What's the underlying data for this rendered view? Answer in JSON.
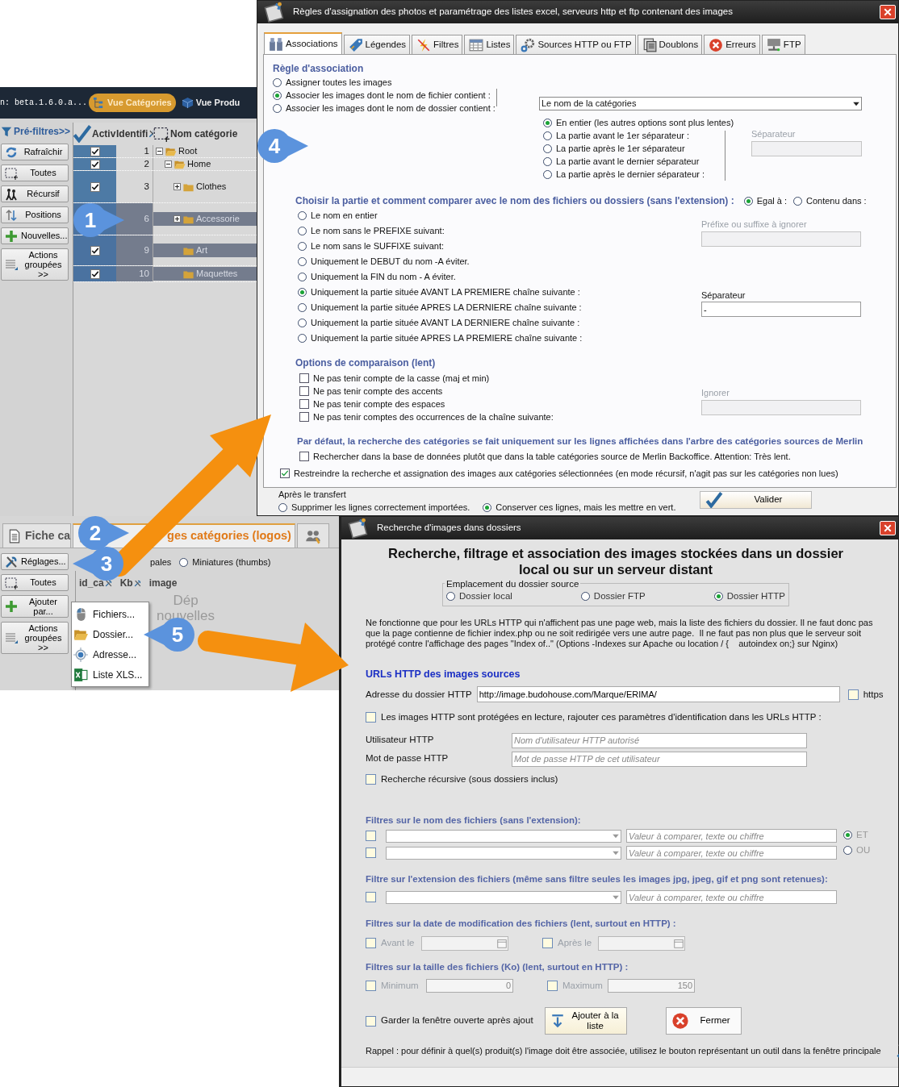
{
  "background_app": {
    "version": "n: beta.1.6.0.a...",
    "view_tabs": [
      {
        "label": "Vue Catégories",
        "selected": true
      },
      {
        "label": "Vue Produ",
        "selected": false
      }
    ],
    "sidebar": [
      "Pré-filtres>>",
      "Rafraîchir",
      "Toutes",
      "Récursif",
      "Positions",
      "Nouvelles...",
      "Actions groupées >>"
    ],
    "grid_columns": [
      "Activ",
      "Identifi",
      "Nom catégorie"
    ],
    "tree": [
      {
        "id": "1",
        "name": "Root",
        "checked": true,
        "selected": false,
        "expanded": true,
        "children": [
          {
            "id": "2",
            "name": "Home",
            "checked": true,
            "selected": false,
            "expanded": true,
            "children": [
              {
                "id": "3",
                "name": "Clothes",
                "checked": true,
                "selected": false,
                "expanded": false
              },
              {
                "id": "6",
                "name": "Accessorie",
                "selected": true,
                "expanded": false
              },
              {
                "id": "9",
                "name": "Art",
                "checked": true,
                "selected": true
              },
              {
                "id": "10",
                "name": "Maquettes",
                "checked": true,
                "selected": true
              }
            ]
          }
        ]
      }
    ],
    "lower_tabs": [
      {
        "label": "Fiche ca",
        "selected": false
      },
      {
        "label": "ges catégories (logos)",
        "selected": true
      }
    ],
    "lower_buttons": [
      "Réglages...",
      "Toutes",
      "Ajouter par...",
      "Actions groupées >>"
    ],
    "image_type_partial": "pales",
    "image_type": [
      {
        "label": "Miniatures (thumbs)",
        "selected": false
      }
    ],
    "image_columns": [
      "id_ca",
      "Kb",
      "image"
    ],
    "drop_hint": [
      "Dép",
      "nouvelles"
    ],
    "context_menu": [
      "Fichiers...",
      "Dossier...",
      "Adresse...",
      "Liste XLS..."
    ]
  },
  "callouts": [
    "1",
    "2",
    "3",
    "4",
    "5"
  ],
  "rules_dialog": {
    "title": "Règles d'assignation des photos et paramétrage des listes excel, serveurs http et ftp contenant des images",
    "tabs": [
      {
        "label": "Associations",
        "selected": true
      },
      {
        "label": "Légendes",
        "selected": false
      },
      {
        "label": "Filtres",
        "selected": false
      },
      {
        "label": "Listes",
        "selected": false
      },
      {
        "label": "Sources HTTP ou FTP",
        "selected": false
      },
      {
        "label": "Doublons",
        "selected": false
      },
      {
        "label": "Erreurs",
        "selected": false
      },
      {
        "label": "FTP",
        "selected": false
      }
    ],
    "association_heading": "Règle d'association",
    "association_rules": [
      {
        "label": "Assigner toutes les images",
        "selected": false
      },
      {
        "label": "Associer les images dont le nom de fichier contient :",
        "selected": true
      },
      {
        "label": "Associer les images dont le nom de dossier contient :",
        "selected": false
      }
    ],
    "source_select": {
      "value": "Le nom de la catégories"
    },
    "name_parts": [
      {
        "label": "En entier (les autres options sont plus lentes)",
        "selected": true
      },
      {
        "label": "La partie avant le 1er séparateur :",
        "selected": false
      },
      {
        "label": "La partie après le 1er séparateur",
        "selected": false
      },
      {
        "label": "La partie avant le dernier séparateur",
        "selected": false
      },
      {
        "label": "La partie après le dernier séparateur :",
        "selected": false
      }
    ],
    "separator_1": {
      "label": "Séparateur",
      "disabled": true
    },
    "compare_heading": "Choisir la partie et comment comparer avec le nom des fichiers ou dossiers (sans l'extension) :",
    "compare_modes": [
      {
        "label": "Egal à :",
        "selected": true
      },
      {
        "label": "Contenu dans :",
        "selected": false
      }
    ],
    "file_parts": [
      {
        "label": "Le nom en entier",
        "selected": false
      },
      {
        "label": "Le nom sans le PREFIXE suivant:",
        "selected": false
      },
      {
        "label": "Le nom sans le SUFFIXE suivant:",
        "selected": false
      },
      {
        "label": "Uniquement le DEBUT du nom -A éviter.",
        "selected": false
      },
      {
        "label": "Uniquement la FIN du nom - A éviter.",
        "selected": false
      },
      {
        "label": "Uniquement la partie située AVANT LA PREMIERE chaîne suivante :",
        "selected": true
      },
      {
        "label": "Uniquement la partie située APRES LA DERNIERE chaîne suivante :",
        "selected": false
      },
      {
        "label": "Uniquement la partie située AVANT LA DERNIERE chaîne suivante :",
        "selected": false
      },
      {
        "label": "Uniquement la partie située APRES LA PREMIERE chaîne suivante :",
        "selected": false
      }
    ],
    "prefix_field": {
      "label": "Préfixe ou suffixe à ignorer",
      "disabled": true
    },
    "separator_2": {
      "label": "Séparateur",
      "value": "-",
      "disabled": false
    },
    "options_heading": "Options de comparaison (lent)",
    "options": [
      {
        "label": "Ne pas tenir compte de la casse (maj et min)",
        "checked": false
      },
      {
        "label": "Ne pas tenir compte des accents",
        "checked": false
      },
      {
        "label": "Ne pas tenir compte des espaces",
        "checked": false
      },
      {
        "label": "Ne pas tenir comptes des occurrences de la chaîne suivante:",
        "checked": false
      }
    ],
    "ignore_field": {
      "label": "Ignorer",
      "disabled": true
    },
    "default_heading": "Par défaut, la recherche des catégories se fait uniquement sur les lignes affichées dans l'arbre des catégories sources de Merlin",
    "db_search": {
      "label": "Rechercher dans la base de données plutôt que dans la table catégories source de Merlin Backoffice. Attention: Très lent.",
      "checked": false
    },
    "restrict": {
      "label": "Restreindre la recherche et assignation des images aux catégories sélectionnées (en mode récursif, n'agit pas sur les catégories non lues)",
      "checked": true
    },
    "after_label": "Après le transfert",
    "after_options": [
      {
        "label": "Supprimer les lignes correctement importées.",
        "selected": false
      },
      {
        "label": "Conserver ces lignes, mais les mettre en vert.",
        "selected": true
      }
    ],
    "validate_button": "Valider"
  },
  "folder_dialog": {
    "title": "Recherche d'images dans dossiers",
    "heading": "Recherche, filtrage et association des images stockées dans un dossier local ou sur un serveur distant",
    "source_group": {
      "legend": "Emplacement du dossier source",
      "options": [
        {
          "label": "Dossier local",
          "selected": false
        },
        {
          "label": "Dossier FTP",
          "selected": false
        },
        {
          "label": "Dossier HTTP",
          "selected": true
        }
      ]
    },
    "note": "Ne fonctionne que pour les URLs HTTP qui n'affichent pas une page web, mais la liste des fichiers du dossier. Il ne faut donc pas que la page contienne de fichier index.php ou ne soit redirigée vers une autre page.  Il ne faut pas non plus que le serveur soit protégé contre l'affichage des pages \"Index of..\" (Options -Indexes sur Apache ou location / {    autoindex on;} sur Nginx)",
    "urls_heading": "URLs HTTP des images sources",
    "address": {
      "label": "Adresse du dossier HTTP",
      "value": "http://image.budohouse.com/Marque/ERIMA/"
    },
    "https": {
      "label": "https",
      "checked": false
    },
    "protected": {
      "label": "Les images HTTP sont protégées en lecture, rajouter ces paramètres d'identification dans les URLs HTTP :",
      "checked": false
    },
    "user": {
      "label": "Utilisateur HTTP",
      "placeholder": "Nom d'utilisateur HTTP autorisé"
    },
    "password": {
      "label": "Mot de passe  HTTP",
      "placeholder": "Mot de passe HTTP de cet utilisateur"
    },
    "recursive": {
      "label": "Recherche récursive (sous dossiers inclus)",
      "checked": false
    },
    "name_filters_heading": "Filtres sur le nom des fichiers (sans l'extension):",
    "name_filters": [
      {
        "checked": false,
        "placeholder": "Valeur à comparer, texte ou chiffre"
      },
      {
        "checked": false,
        "placeholder": "Valeur à comparer, texte ou chiffre"
      }
    ],
    "logic": [
      {
        "label": "ET",
        "selected": true
      },
      {
        "label": "OU",
        "selected": false
      }
    ],
    "ext_heading": "Filtre sur l'extension des fichiers (même sans filtre seules les images jpg, jpeg, gif et png sont retenues):",
    "ext_filter": {
      "checked": false,
      "placeholder": "Valeur à comparer, texte ou chiffre"
    },
    "date_heading": "Filtres sur la date de modification des fichiers (lent, surtout en HTTP) :",
    "date_filters": [
      {
        "label": "Avant le",
        "checked": false,
        "disabled": true
      },
      {
        "label": "Après le",
        "checked": false,
        "disabled": true
      }
    ],
    "size_heading": "Filtres sur la taille des fichiers (Ko) (lent, surtout en HTTP) :",
    "size_filters": [
      {
        "label": "Minimum",
        "value": "0",
        "checked": false,
        "disabled": true
      },
      {
        "label": "Maximum",
        "value": "150",
        "checked": false,
        "disabled": true
      }
    ],
    "keep_open": {
      "label": "Garder la fenêtre ouverte après ajout",
      "checked": false
    },
    "add_button": "Ajouter à la liste",
    "close_button": "Fermer",
    "reminder": "Rappel : pour définir à quel(s) produit(s) l'image doit être associée, utilisez le bouton représentant un outil dans la fenêtre principale"
  }
}
